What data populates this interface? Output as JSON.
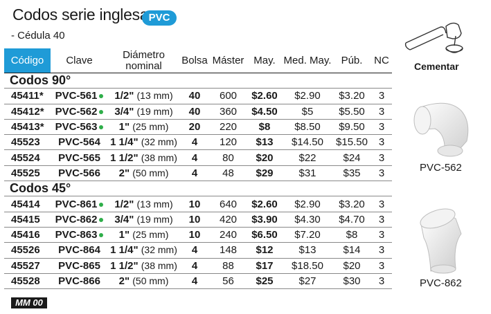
{
  "header": {
    "title": "Codos serie inglesa",
    "badge": "PVC",
    "subtitle": "- Cédula 40"
  },
  "columns": {
    "code": "Código",
    "clave": "Clave",
    "diam1": "Diámetro",
    "diam2": "nominal",
    "bolsa": "Bolsa",
    "master": "Máster",
    "may": "May.",
    "medmay": "Med. May.",
    "pub": "Púb.",
    "nc": "NC"
  },
  "sections": [
    {
      "title": "Codos 90°",
      "rows": [
        {
          "code": "45411*",
          "clave": "PVC-561",
          "dot": true,
          "size": "1/2\"",
          "mm": "(13 mm)",
          "bolsa": "40",
          "master": "600",
          "may": "$2.60",
          "medmay": "$2.90",
          "pub": "$3.20",
          "nc": "3"
        },
        {
          "code": "45412*",
          "clave": "PVC-562",
          "dot": true,
          "size": "3/4\"",
          "mm": "(19 mm)",
          "bolsa": "40",
          "master": "360",
          "may": "$4.50",
          "medmay": "$5",
          "pub": "$5.50",
          "nc": "3"
        },
        {
          "code": "45413*",
          "clave": "PVC-563",
          "dot": true,
          "size": "1\"",
          "mm": "(25 mm)",
          "bolsa": "20",
          "master": "220",
          "may": "$8",
          "medmay": "$8.50",
          "pub": "$9.50",
          "nc": "3"
        },
        {
          "code": "45523",
          "clave": "PVC-564",
          "dot": false,
          "size": "1 1/4\"",
          "mm": "(32 mm)",
          "bolsa": "4",
          "master": "120",
          "may": "$13",
          "medmay": "$14.50",
          "pub": "$15.50",
          "nc": "3"
        },
        {
          "code": "45524",
          "clave": "PVC-565",
          "dot": false,
          "size": "1 1/2\"",
          "mm": "(38 mm)",
          "bolsa": "4",
          "master": "80",
          "may": "$20",
          "medmay": "$22",
          "pub": "$24",
          "nc": "3"
        },
        {
          "code": "45525",
          "clave": "PVC-566",
          "dot": false,
          "size": "2\"",
          "mm": "(50 mm)",
          "bolsa": "4",
          "master": "48",
          "may": "$29",
          "medmay": "$31",
          "pub": "$35",
          "nc": "3"
        }
      ]
    },
    {
      "title": "Codos 45°",
      "rows": [
        {
          "code": "45414",
          "clave": "PVC-861",
          "dot": true,
          "size": "1/2\"",
          "mm": "(13 mm)",
          "bolsa": "10",
          "master": "640",
          "may": "$2.60",
          "medmay": "$2.90",
          "pub": "$3.20",
          "nc": "3"
        },
        {
          "code": "45415",
          "clave": "PVC-862",
          "dot": true,
          "size": "3/4\"",
          "mm": "(19 mm)",
          "bolsa": "10",
          "master": "420",
          "may": "$3.90",
          "medmay": "$4.30",
          "pub": "$4.70",
          "nc": "3"
        },
        {
          "code": "45416",
          "clave": "PVC-863",
          "dot": true,
          "size": "1\"",
          "mm": "(25 mm)",
          "bolsa": "10",
          "master": "240",
          "may": "$6.50",
          "medmay": "$7.20",
          "pub": "$8",
          "nc": "3"
        },
        {
          "code": "45526",
          "clave": "PVC-864",
          "dot": false,
          "size": "1 1/4\"",
          "mm": "(32 mm)",
          "bolsa": "4",
          "master": "148",
          "may": "$12",
          "medmay": "$13",
          "pub": "$14",
          "nc": "3"
        },
        {
          "code": "45527",
          "clave": "PVC-865",
          "dot": false,
          "size": "1 1/2\"",
          "mm": "(38 mm)",
          "bolsa": "4",
          "master": "88",
          "may": "$17",
          "medmay": "$18.50",
          "pub": "$20",
          "nc": "3"
        },
        {
          "code": "45528",
          "clave": "PVC-866",
          "dot": false,
          "size": "2\"",
          "mm": "(50 mm)",
          "bolsa": "4",
          "master": "56",
          "may": "$25",
          "medmay": "$27",
          "pub": "$30",
          "nc": "3"
        }
      ]
    }
  ],
  "side": {
    "cementar": "Cementar",
    "img1_label": "PVC-562",
    "img2_label": "PVC-862"
  },
  "footer": {
    "tag": "MM 00"
  },
  "colors": {
    "accent": "#1f9bd7",
    "dot": "#2eae49"
  }
}
